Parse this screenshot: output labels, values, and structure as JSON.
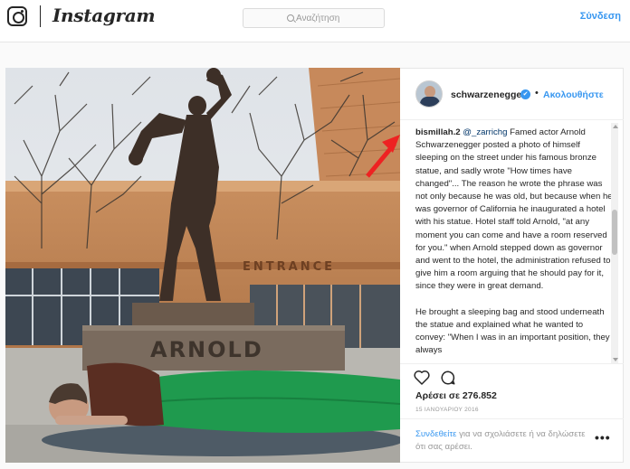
{
  "header": {
    "brand": "Instagram",
    "search_placeholder": "Αναζήτηση",
    "login_label": "Σύνδεση"
  },
  "photo": {
    "statue_plaque": "ARNOLD",
    "building_sign": "ENTRANCE"
  },
  "post": {
    "username": "schwarzenegger",
    "verified_mark": "✔",
    "separator": "•",
    "follow_label": "Ακολουθήστε",
    "comment": {
      "user": "bismillah.2",
      "mention": "@_zarrichg",
      "paragraph1": "Famed actor Arnold Schwarzenegger posted a photo of himself sleeping on the street under his famous bronze statue, and sadly wrote \"How times have changed\"... The reason he wrote the phrase was not only because he was old, but because when he was governor of California he inaugurated a hotel with his statue. Hotel staff told Arnold, \"at any moment you can come and have a room reserved for you.\" when Arnold stepped down as governor and went to the hotel, the administration refused to give him a room arguing that he should pay for it, since they were in great demand.",
      "paragraph2": "He brought a sleeping bag and stood underneath the statue and explained what he wanted to convey: \"When I was in an important position, they always"
    },
    "likes": "Αρέσει σε 276.852",
    "date": "15 ΙΑΝΟΥΑΡΙΟΥ 2016",
    "login_prompt": {
      "link": "Συνδεθείτε",
      "text": " για να σχολιάσετε ή να δηλώσετε ότι σας αρέσει."
    },
    "more_label": "•••"
  },
  "colors": {
    "accent": "#3897f0",
    "annotation_arrow": "#ee2222",
    "sleeping_bag": "#1f9a4e"
  }
}
